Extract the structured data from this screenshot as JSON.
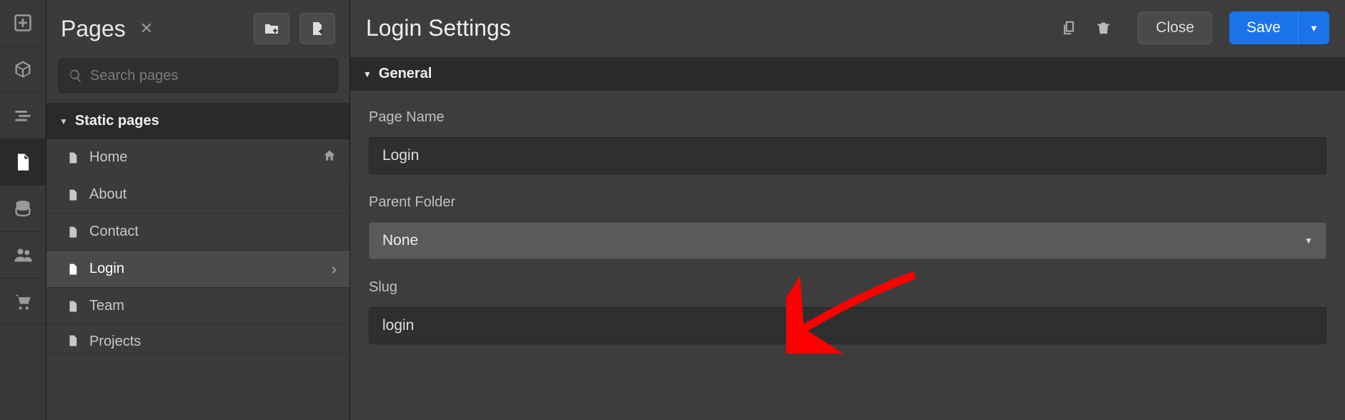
{
  "panel": {
    "title": "Pages",
    "search_placeholder": "Search pages",
    "section_label": "Static pages",
    "items": [
      {
        "label": "Home",
        "home_icon": true
      },
      {
        "label": "About"
      },
      {
        "label": "Contact"
      },
      {
        "label": "Login",
        "selected": true,
        "chevron": true
      },
      {
        "label": "Team"
      },
      {
        "label": "Projects"
      }
    ]
  },
  "settings": {
    "title": "Login Settings",
    "close_label": "Close",
    "save_label": "Save",
    "section_general": "General",
    "fields": {
      "page_name_label": "Page Name",
      "page_name_value": "Login",
      "parent_folder_label": "Parent Folder",
      "parent_folder_value": "None",
      "slug_label": "Slug",
      "slug_value": "login"
    }
  }
}
